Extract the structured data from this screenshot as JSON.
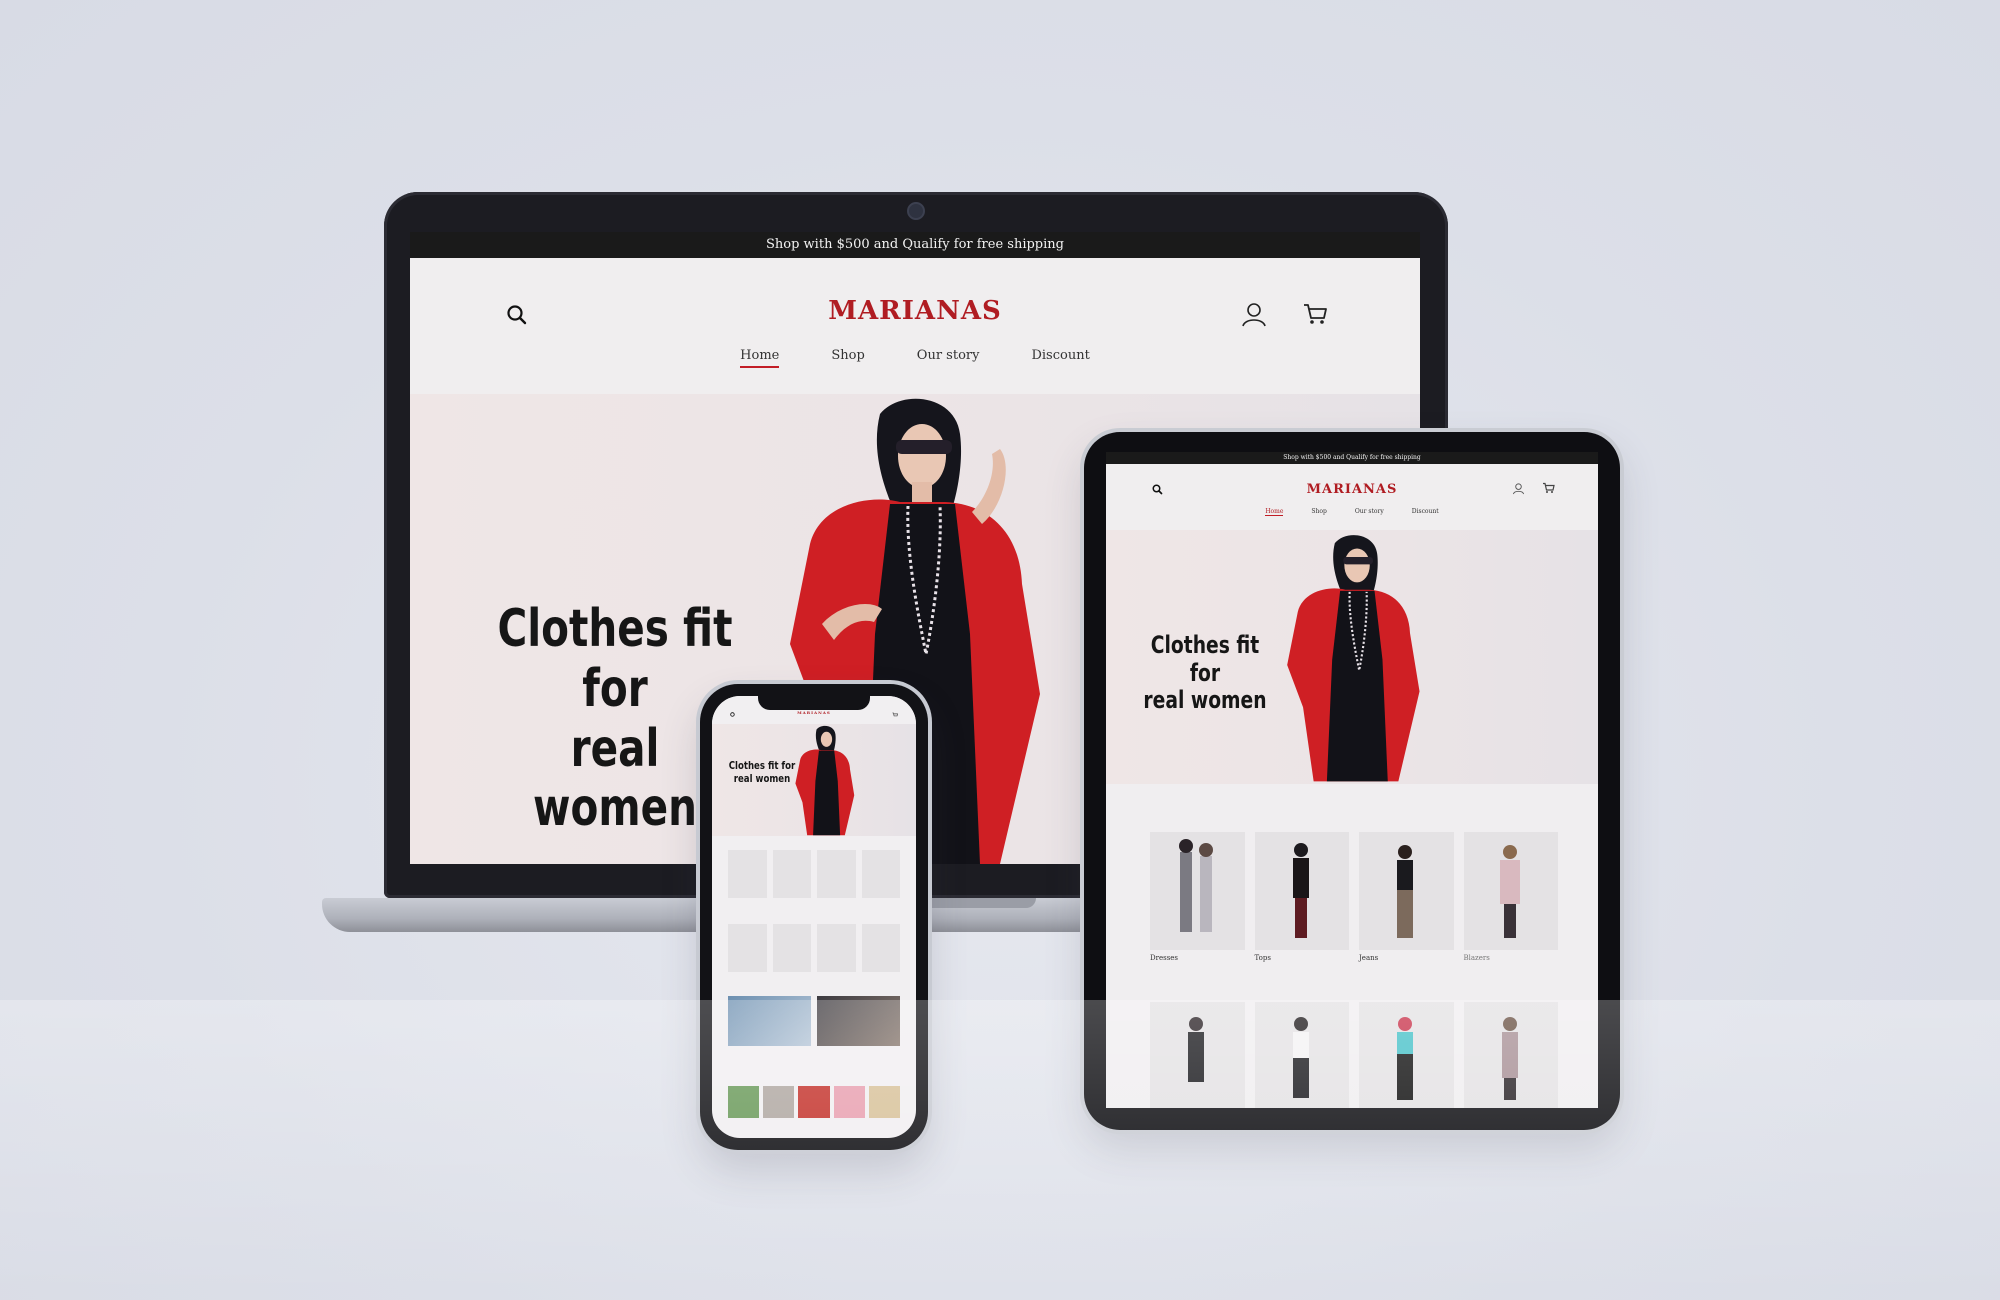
{
  "colors": {
    "brand": "#b01c22",
    "promo_bar": "#1a1a1a",
    "hero_bg": "#efe6e6",
    "coat_red": "#cf1f24",
    "background": "#dcdfe8"
  },
  "site": {
    "promo": "Shop with $500 and Qualify for free shipping",
    "brand": "MARIANAS",
    "nav": [
      "Home",
      "Shop",
      "Our story",
      "Discount"
    ],
    "active_nav": "Home",
    "hero_line1": "Clothes fit for",
    "hero_line2": "real women",
    "icons": [
      "search-icon",
      "user-icon",
      "cart-icon"
    ]
  },
  "tablet": {
    "categories": [
      "Dresses",
      "Tops",
      "Jeans",
      "Blazers"
    ]
  }
}
